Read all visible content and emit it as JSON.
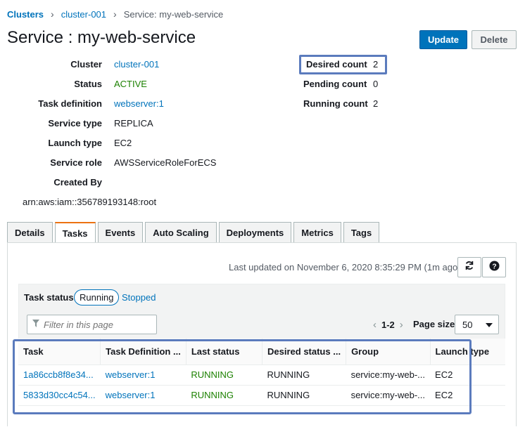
{
  "breadcrumb": {
    "items": [
      "Clusters",
      "cluster-001",
      "Service: my-web-service"
    ]
  },
  "page_title": "Service : my-web-service",
  "buttons": {
    "update": "Update",
    "delete": "Delete"
  },
  "details_left": [
    {
      "label": "Cluster",
      "value": "cluster-001",
      "style": "link"
    },
    {
      "label": "Status",
      "value": "ACTIVE",
      "style": "green"
    },
    {
      "label": "Task definition",
      "value": "webserver:1",
      "style": "link"
    },
    {
      "label": "Service type",
      "value": "REPLICA",
      "style": "plain"
    },
    {
      "label": "Launch type",
      "value": "EC2",
      "style": "plain"
    },
    {
      "label": "Service role",
      "value": "AWSServiceRoleForECS",
      "style": "plain"
    },
    {
      "label": "Created By",
      "value": "",
      "style": "plain"
    }
  ],
  "created_by_value": "arn:aws:iam::356789193148:root",
  "details_right": [
    {
      "label": "Desired count",
      "value": "2"
    },
    {
      "label": "Pending count",
      "value": "0"
    },
    {
      "label": "Running count",
      "value": "2"
    }
  ],
  "tabs": [
    "Details",
    "Tasks",
    "Events",
    "Auto Scaling",
    "Deployments",
    "Metrics",
    "Tags"
  ],
  "active_tab": "Tasks",
  "last_updated": "Last updated on November 6, 2020 8:35:29 PM (1m ago)",
  "task_status": {
    "label": "Task status:",
    "running": "Running",
    "stopped": "Stopped"
  },
  "filter": {
    "placeholder": "Filter in this page"
  },
  "pagination": {
    "range": "1-2",
    "page_size_label": "Page size",
    "page_size": "50"
  },
  "table": {
    "headers": [
      "Task",
      "Task Definition ...",
      "Last status",
      "Desired status ...",
      "Group",
      "Launch type"
    ],
    "rows": [
      [
        "1a86ccb8f8e34...",
        "webserver:1",
        "RUNNING",
        "RUNNING",
        "service:my-web-...",
        "EC2"
      ],
      [
        "5833d30cc4c54...",
        "webserver:1",
        "RUNNING",
        "RUNNING",
        "service:my-web-...",
        "EC2"
      ]
    ]
  },
  "colors": {
    "link": "#0073bb",
    "primary_button": "#0073bb",
    "status_green": "#1d8102",
    "active_tab_accent": "#ec7211",
    "annotation_box": "#5b7bbd"
  },
  "icons": [
    "chevron-right-icon",
    "refresh-icon",
    "help-icon",
    "filter-icon",
    "chevron-left-icon",
    "caret-down-icon"
  ]
}
